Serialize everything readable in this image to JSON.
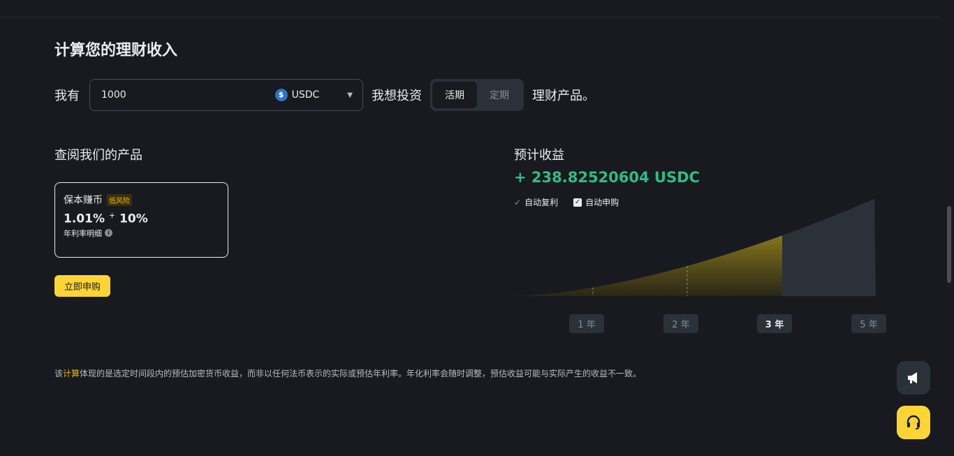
{
  "section_title": "计算您的理财收入",
  "calculator": {
    "have_label": "我有",
    "amount_value": "1000",
    "coin": "USDC",
    "want_label": "我想投资",
    "options": [
      "活期",
      "定期"
    ],
    "selected_option": "活期",
    "suffix": "理财产品。"
  },
  "products": {
    "heading": "查阅我们的产品",
    "card": {
      "name": "保本赚币",
      "risk_badge": "低风险",
      "rate_base": "1.01%",
      "rate_plus": "+",
      "rate_bonus": "10%",
      "rate_label": "年利率明细"
    },
    "buy_button": "立即申购"
  },
  "estimate": {
    "heading": "预计收益",
    "amount": "+ 238.82520604 USDC",
    "auto_compound": "自动复利",
    "auto_subscribe": "自动申购",
    "auto_subscribe_checked": true
  },
  "chart_data": {
    "type": "area",
    "categories": [
      "1 年",
      "2 年",
      "3 年",
      "5 年"
    ],
    "selected": "3 年",
    "series": [
      {
        "values": [
          0.25,
          0.52,
          0.85,
          1.0
        ]
      }
    ],
    "highlight_until": "3 年",
    "colors": {
      "highlight": "#f0b90b",
      "rest": "#2b3139"
    }
  },
  "disclaimer": {
    "prefix": "该",
    "highlight": "计算",
    "rest": "体现的是选定时间段内的预估加密货币收益，而非以任何法币表示的实际或预估年利率。年化利率会随时调整，预估收益可能与实际产生的收益不一致。"
  },
  "colors": {
    "background": "#181a20",
    "accent": "#fcd535",
    "positive": "#2ebd85"
  }
}
